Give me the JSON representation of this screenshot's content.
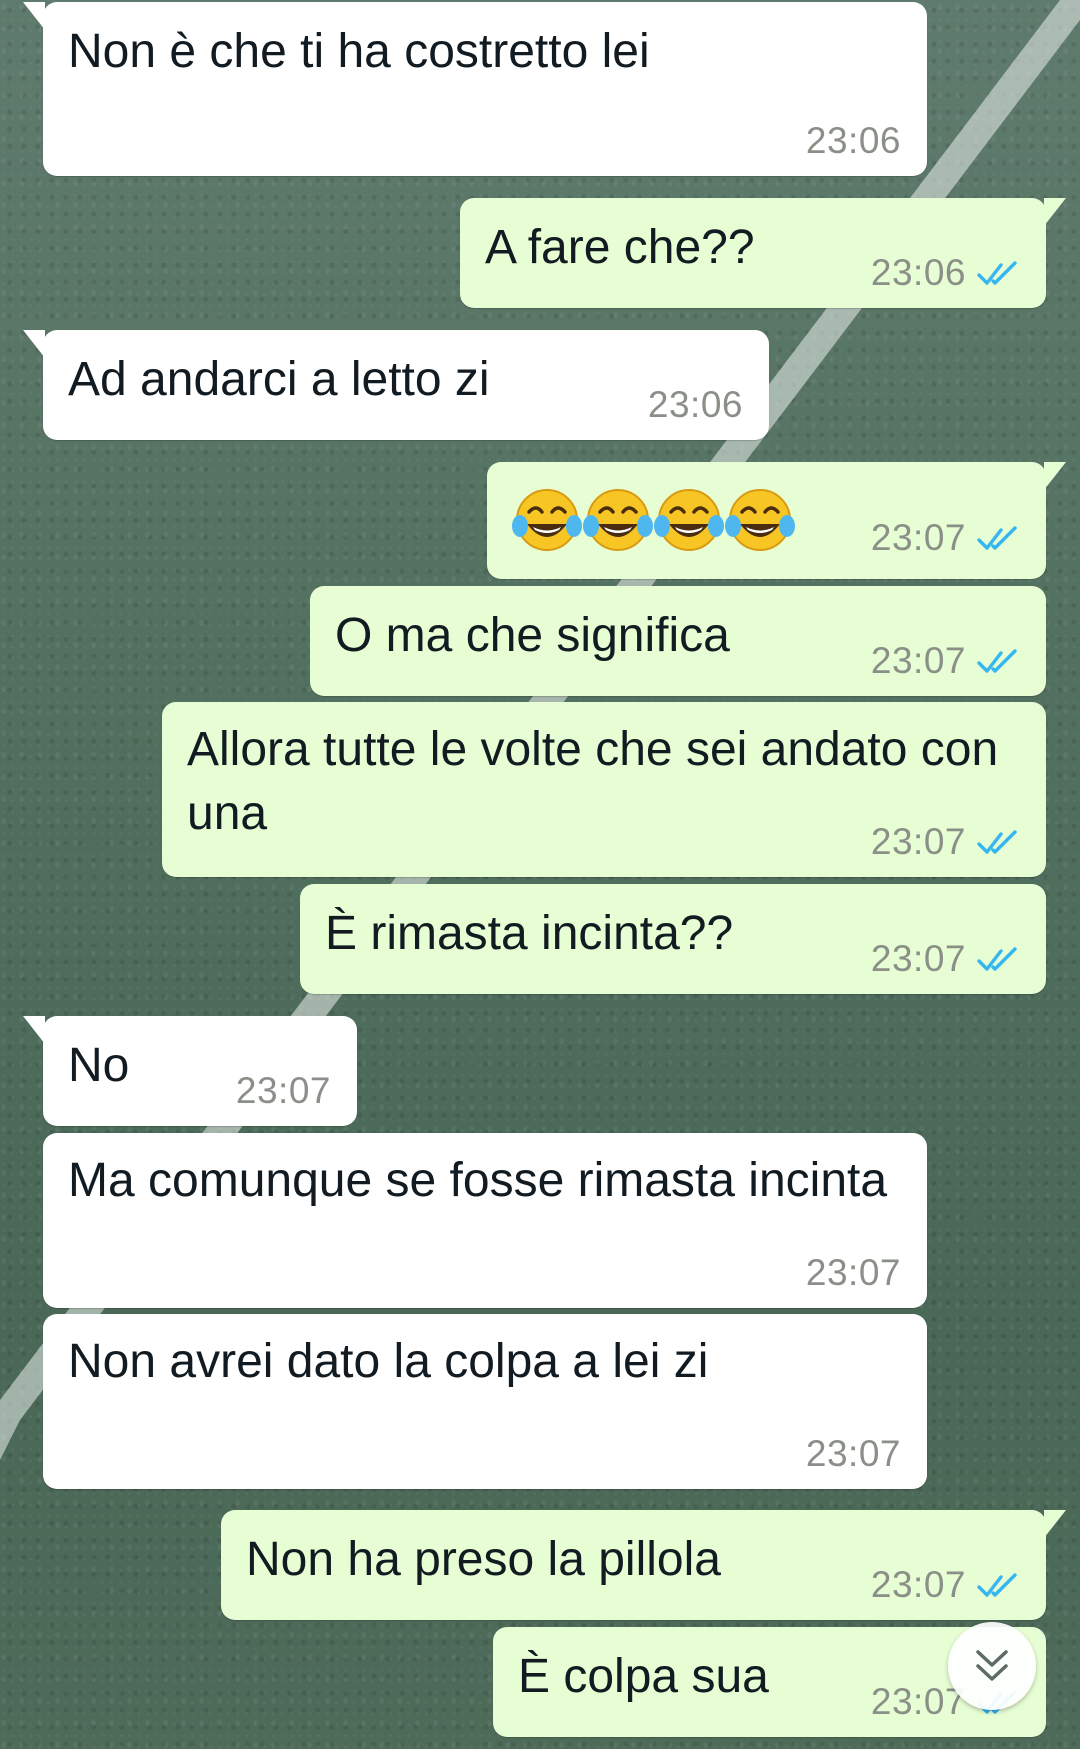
{
  "messages": [
    {
      "direction": "incoming",
      "text": "Non è che ti ha costretto lei",
      "time": "23:06"
    },
    {
      "direction": "outgoing",
      "text": "A fare che??",
      "time": "23:06",
      "status": "read"
    },
    {
      "direction": "incoming",
      "text": "Ad andarci a letto zi",
      "time": "23:06"
    },
    {
      "direction": "outgoing",
      "text": "😂😂😂😂",
      "time": "23:07",
      "status": "read",
      "emoji": [
        "face-with-tears-of-joy",
        "face-with-tears-of-joy",
        "face-with-tears-of-joy",
        "face-with-tears-of-joy"
      ]
    },
    {
      "direction": "outgoing",
      "text": "O ma che significa",
      "time": "23:07",
      "status": "read"
    },
    {
      "direction": "outgoing",
      "text": "Allora tutte le volte che sei andato con una",
      "time": "23:07",
      "status": "read"
    },
    {
      "direction": "outgoing",
      "text": "È rimasta incinta??",
      "time": "23:07",
      "status": "read"
    },
    {
      "direction": "incoming",
      "text": "No",
      "time": "23:07"
    },
    {
      "direction": "incoming",
      "text": "Ma comunque se fosse rimasta incinta",
      "time": "23:07"
    },
    {
      "direction": "incoming",
      "text": "Non avrei dato la colpa a lei zi",
      "time": "23:07"
    },
    {
      "direction": "outgoing",
      "text": "Non ha preso la pillola",
      "time": "23:07",
      "status": "read"
    },
    {
      "direction": "outgoing",
      "text": "È colpa sua",
      "time": "23:07",
      "status": "read"
    }
  ],
  "scroll_button": {
    "icon": "double-chevron-down-icon"
  },
  "colors": {
    "incoming_bubble": "#ffffff",
    "outgoing_bubble": "#e7fdd3",
    "read_ticks": "#34b7f1",
    "timestamp": "#8a9088",
    "message_text": "#111b21"
  },
  "wallpaper": {
    "description_icon": "grass-field-wallpaper"
  }
}
